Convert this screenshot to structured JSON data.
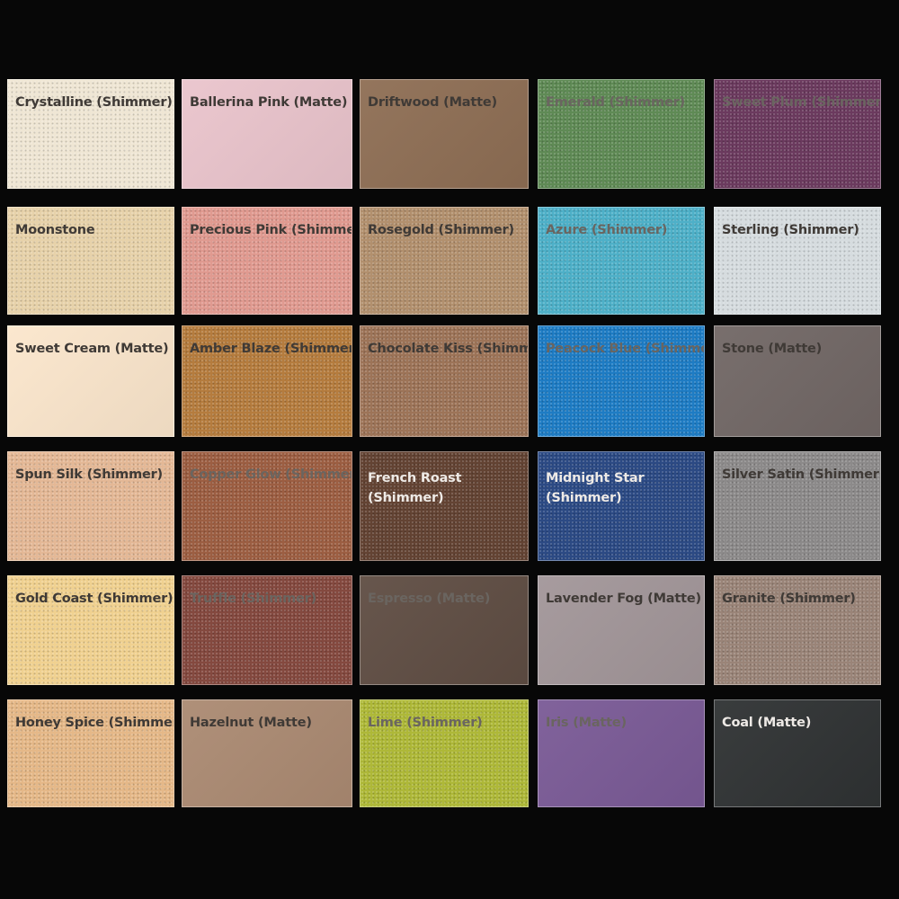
{
  "palette": {
    "background": "#070707",
    "rows": [
      [
        {
          "name": "Crystalline (Shimmer)",
          "color": "#efe6d4",
          "finish": "shimmer",
          "text": "dark"
        },
        {
          "name": "Ballerina Pink (Matte)",
          "color": "#eac4cc",
          "finish": "matte",
          "text": "dark"
        },
        {
          "name": "Driftwood (Matte)",
          "color": "#8e6e54",
          "finish": "matte",
          "text": "dark"
        },
        {
          "name": "Emerald (Shimmer)",
          "color": "#5f8a55",
          "finish": "shimmer",
          "text": "muted"
        },
        {
          "name": "Sweet Plum (Shimmer)",
          "color": "#6b3a5e",
          "finish": "shimmer",
          "text": "muted"
        }
      ],
      [
        {
          "name": "Moonstone",
          "color": "#e7d2aa",
          "finish": "shimmer",
          "text": "dark"
        },
        {
          "name": "Precious Pink (Shimmer)",
          "color": "#e09a90",
          "finish": "shimmer",
          "text": "dark"
        },
        {
          "name": "Rosegold (Shimmer)",
          "color": "#b2906e",
          "finish": "shimmer",
          "text": "dark"
        },
        {
          "name": "Azure (Shimmer)",
          "color": "#4eb0c8",
          "finish": "shimmer",
          "text": "muted"
        },
        {
          "name": "Sterling (Shimmer)",
          "color": "#d6dcdf",
          "finish": "shimmer",
          "text": "dark"
        }
      ],
      [
        {
          "name": "Sweet Cream (Matte)",
          "color": "#fbe6cc",
          "finish": "matte",
          "text": "dark"
        },
        {
          "name": "Amber Blaze (Shimmer)",
          "color": "#b57c3e",
          "finish": "shimmer",
          "text": "dark"
        },
        {
          "name": "Chocolate Kiss (Shimmer)",
          "color": "#9d7458",
          "finish": "shimmer",
          "text": "dark"
        },
        {
          "name": "Peacock Blue (Shimmer)",
          "color": "#1e7cc4",
          "finish": "shimmer",
          "text": "muted"
        },
        {
          "name": "Stone (Matte)",
          "color": "#716765",
          "finish": "matte",
          "text": "dark"
        }
      ],
      [
        {
          "name": "Spun Silk (Shimmer)",
          "color": "#e4b896",
          "finish": "shimmer",
          "text": "dark"
        },
        {
          "name": "Copper Glow (Shimmer)",
          "color": "#9c5e42",
          "finish": "shimmer",
          "text": "muted"
        },
        {
          "name": "French Roast (Shimmer)",
          "color": "#634333",
          "finish": "shimmer",
          "text": "light"
        },
        {
          "name": "Midnight Star (Shimmer)",
          "color": "#2c4a84",
          "finish": "shimmer",
          "text": "light"
        },
        {
          "name": "Silver Satin (Shimmer)",
          "color": "#8c8a8a",
          "finish": "shimmer",
          "text": "dark"
        }
      ],
      [
        {
          "name": "Gold Coast (Shimmer)",
          "color": "#f0d190",
          "finish": "shimmer",
          "text": "dark"
        },
        {
          "name": "Truffle (Shimmer)",
          "color": "#84493f",
          "finish": "shimmer",
          "text": "muted"
        },
        {
          "name": "Espresso (Matte)",
          "color": "#5f4d43",
          "finish": "matte",
          "text": "muted"
        },
        {
          "name": "Lavender Fog (Matte)",
          "color": "#a29699",
          "finish": "matte",
          "text": "dark"
        },
        {
          "name": "Granite (Shimmer)",
          "color": "#9a8478",
          "finish": "shimmer",
          "text": "dark"
        }
      ],
      [
        {
          "name": "Honey Spice (Shimmer)",
          "color": "#e5b888",
          "finish": "shimmer",
          "text": "dark"
        },
        {
          "name": "Hazelnut (Matte)",
          "color": "#ab8a72",
          "finish": "matte",
          "text": "dark"
        },
        {
          "name": "Lime (Shimmer)",
          "color": "#aeb838",
          "finish": "shimmer",
          "text": "muted"
        },
        {
          "name": "Iris (Matte)",
          "color": "#7a5a96",
          "finish": "matte",
          "text": "muted"
        },
        {
          "name": "Coal (Matte)",
          "color": "#2f3233",
          "finish": "matte",
          "text": "light"
        }
      ]
    ]
  }
}
